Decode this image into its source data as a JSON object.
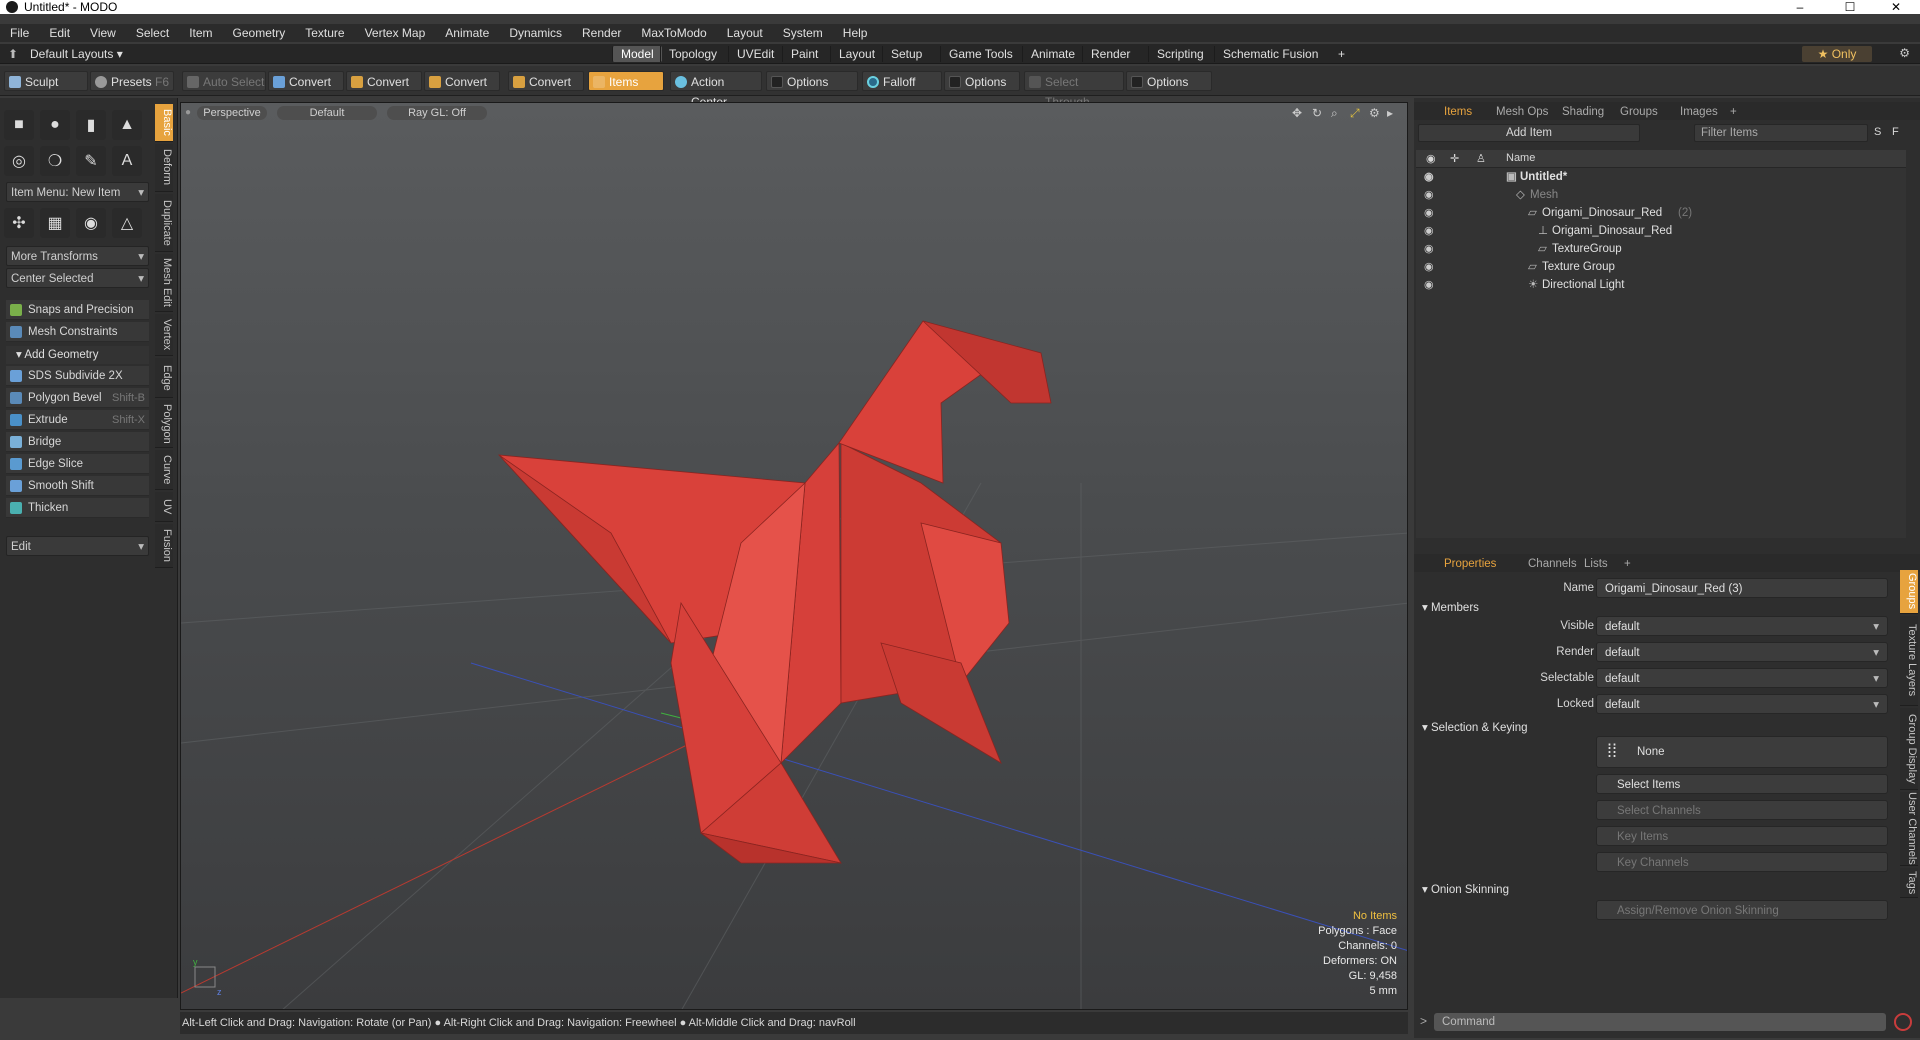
{
  "window": {
    "title": "Untitled* - MODO",
    "minimize": "–",
    "maximize": "☐",
    "close": "✕"
  },
  "menu": [
    "File",
    "Edit",
    "View",
    "Select",
    "Item",
    "Geometry",
    "Texture",
    "Vertex Map",
    "Animate",
    "Dynamics",
    "Render",
    "MaxToModo",
    "Layout",
    "System",
    "Help"
  ],
  "layouts": {
    "label": "Default Layouts ▾",
    "tabs": [
      "Model",
      "Topology",
      "UVEdit",
      "Paint",
      "Layout",
      "Setup",
      "Game Tools",
      "Animate",
      "Render",
      "Scripting",
      "Schematic Fusion"
    ],
    "active": "Model",
    "add": "+",
    "only": "★  Only"
  },
  "toolbar": {
    "sculpt": "Sculpt",
    "presets": "Presets",
    "presets_key": "F6",
    "auto_select": "Auto Select",
    "convert1": "Convert",
    "convert2": "Convert",
    "convert3": "Convert",
    "convert4": "Convert",
    "items": "Items",
    "action_center": "Action Center",
    "options1": "Options",
    "falloff": "Falloff",
    "options2": "Options",
    "select_through": "Select Through",
    "options3": "Options"
  },
  "left": {
    "item_menu": "Item Menu: New Item",
    "more_transforms": "More Transforms",
    "center_selected": "Center Selected",
    "snaps": "Snaps and Precision",
    "mesh_constraints": "Mesh Constraints",
    "add_geometry": "Add Geometry",
    "tools": [
      {
        "label": "SDS Subdivide 2X",
        "key": ""
      },
      {
        "label": "Polygon Bevel",
        "key": "Shift-B"
      },
      {
        "label": "Extrude",
        "key": "Shift-X"
      },
      {
        "label": "Bridge",
        "key": ""
      },
      {
        "label": "Edge Slice",
        "key": ""
      },
      {
        "label": "Smooth Shift",
        "key": ""
      },
      {
        "label": "Thicken",
        "key": ""
      }
    ],
    "edit": "Edit",
    "vtabs": [
      "Basic",
      "Deform",
      "Duplicate",
      "Mesh Edit",
      "Vertex",
      "Edge",
      "Polygon",
      "Curve",
      "UV",
      "Fusion"
    ]
  },
  "viewport": {
    "view": "Perspective",
    "shading": "Default",
    "raygl": "Ray GL: Off",
    "stats": {
      "items": "No Items",
      "polygons": "Polygons : Face",
      "channels": "Channels: 0",
      "deformers": "Deformers: ON",
      "gl": "GL: 9,458",
      "unit": "5 mm"
    },
    "colors": {
      "mesh": "#d9413a",
      "mesh_dark": "#b8322c",
      "mesh_light": "#e5524a"
    }
  },
  "status": "Alt-Left Click and Drag: Navigation: Rotate (or Pan) ● Alt-Right Click and Drag: Navigation: Freewheel ● Alt-Middle Click and Drag: navRoll",
  "items_panel": {
    "tabs": [
      "Items",
      "Mesh Ops",
      "Shading",
      "Groups",
      "Images",
      "+"
    ],
    "add_item": "Add Item",
    "filter": "Filter Items",
    "s": "S",
    "f": "F",
    "col_name": "Name",
    "rows": [
      {
        "label": "Untitled*",
        "suffix": ""
      },
      {
        "label": "Mesh",
        "suffix": ""
      },
      {
        "label": "Origami_Dinosaur_Red",
        "suffix": "(2)"
      },
      {
        "label": "Origami_Dinosaur_Red",
        "suffix": ""
      },
      {
        "label": "TextureGroup",
        "suffix": ""
      },
      {
        "label": "Texture Group",
        "suffix": ""
      },
      {
        "label": "Directional Light",
        "suffix": ""
      }
    ]
  },
  "properties": {
    "tabs": [
      "Properties",
      "Channels",
      "Lists",
      "+"
    ],
    "name_label": "Name",
    "name_value": "Origami_Dinosaur_Red (3)",
    "members": "Members",
    "visible_label": "Visible",
    "visible": "default",
    "render_label": "Render",
    "render": "default",
    "selectable_label": "Selectable",
    "selectable": "default",
    "locked_label": "Locked",
    "locked": "default",
    "sel_keying": "Selection & Keying",
    "none": "None",
    "select_items": "Select Items",
    "select_channels": "Select Channels",
    "key_items": "Key Items",
    "key_channels": "Key Channels",
    "onion": "Onion Skinning",
    "onion_btn": "Assign/Remove Onion Skinning",
    "vtabs": [
      "Groups",
      "Texture Layers",
      "Group Display",
      "User Channels",
      "Tags"
    ],
    "command": "Command"
  }
}
